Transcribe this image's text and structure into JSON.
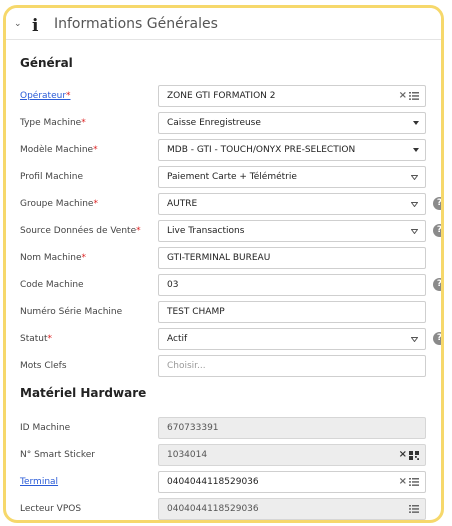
{
  "header": {
    "title": "Informations Générales",
    "chevron_icon": "chevron-down-icon",
    "info_icon": "info-icon",
    "info_glyph": "i"
  },
  "required_mark": "*",
  "help_glyph": "?",
  "clear_glyph": "×",
  "placeholder_mots_clefs": "Choisir...",
  "general": {
    "title": "Général",
    "fields": {
      "operateur": {
        "label": "Opérateur",
        "value": "ZONE GTI FORMATION 2"
      },
      "type_machine": {
        "label": "Type Machine",
        "value": "Caisse Enregistreuse"
      },
      "modele_machine": {
        "label": "Modèle Machine",
        "value": "MDB - GTI - TOUCH/ONYX PRE-SELECTION"
      },
      "profil_machine": {
        "label": "Profil Machine",
        "value": "Paiement Carte + Télémétrie"
      },
      "groupe_machine": {
        "label": "Groupe Machine",
        "value": "AUTRE"
      },
      "source_donnees": {
        "label": "Source Données de Vente",
        "value": "Live Transactions"
      },
      "nom_machine": {
        "label": "Nom Machine",
        "value": "GTI-TERMINAL BUREAU"
      },
      "code_machine": {
        "label": "Code Machine",
        "value": "03"
      },
      "numero_serie": {
        "label": "Numéro Série Machine",
        "value": "TEST CHAMP"
      },
      "statut": {
        "label": "Statut",
        "value": "Actif"
      },
      "mots_clefs": {
        "label": "Mots Clefs",
        "value": ""
      }
    }
  },
  "hardware": {
    "title": "Matériel Hardware",
    "fields": {
      "id_machine": {
        "label": "ID Machine",
        "value": "670733391"
      },
      "smart_sticker": {
        "label": "N° Smart Sticker",
        "value": "1034014"
      },
      "terminal": {
        "label": "Terminal",
        "value": "0404044118529036"
      },
      "lecteur_vpos": {
        "label": "Lecteur VPOS",
        "value": "0404044118529036"
      }
    }
  }
}
